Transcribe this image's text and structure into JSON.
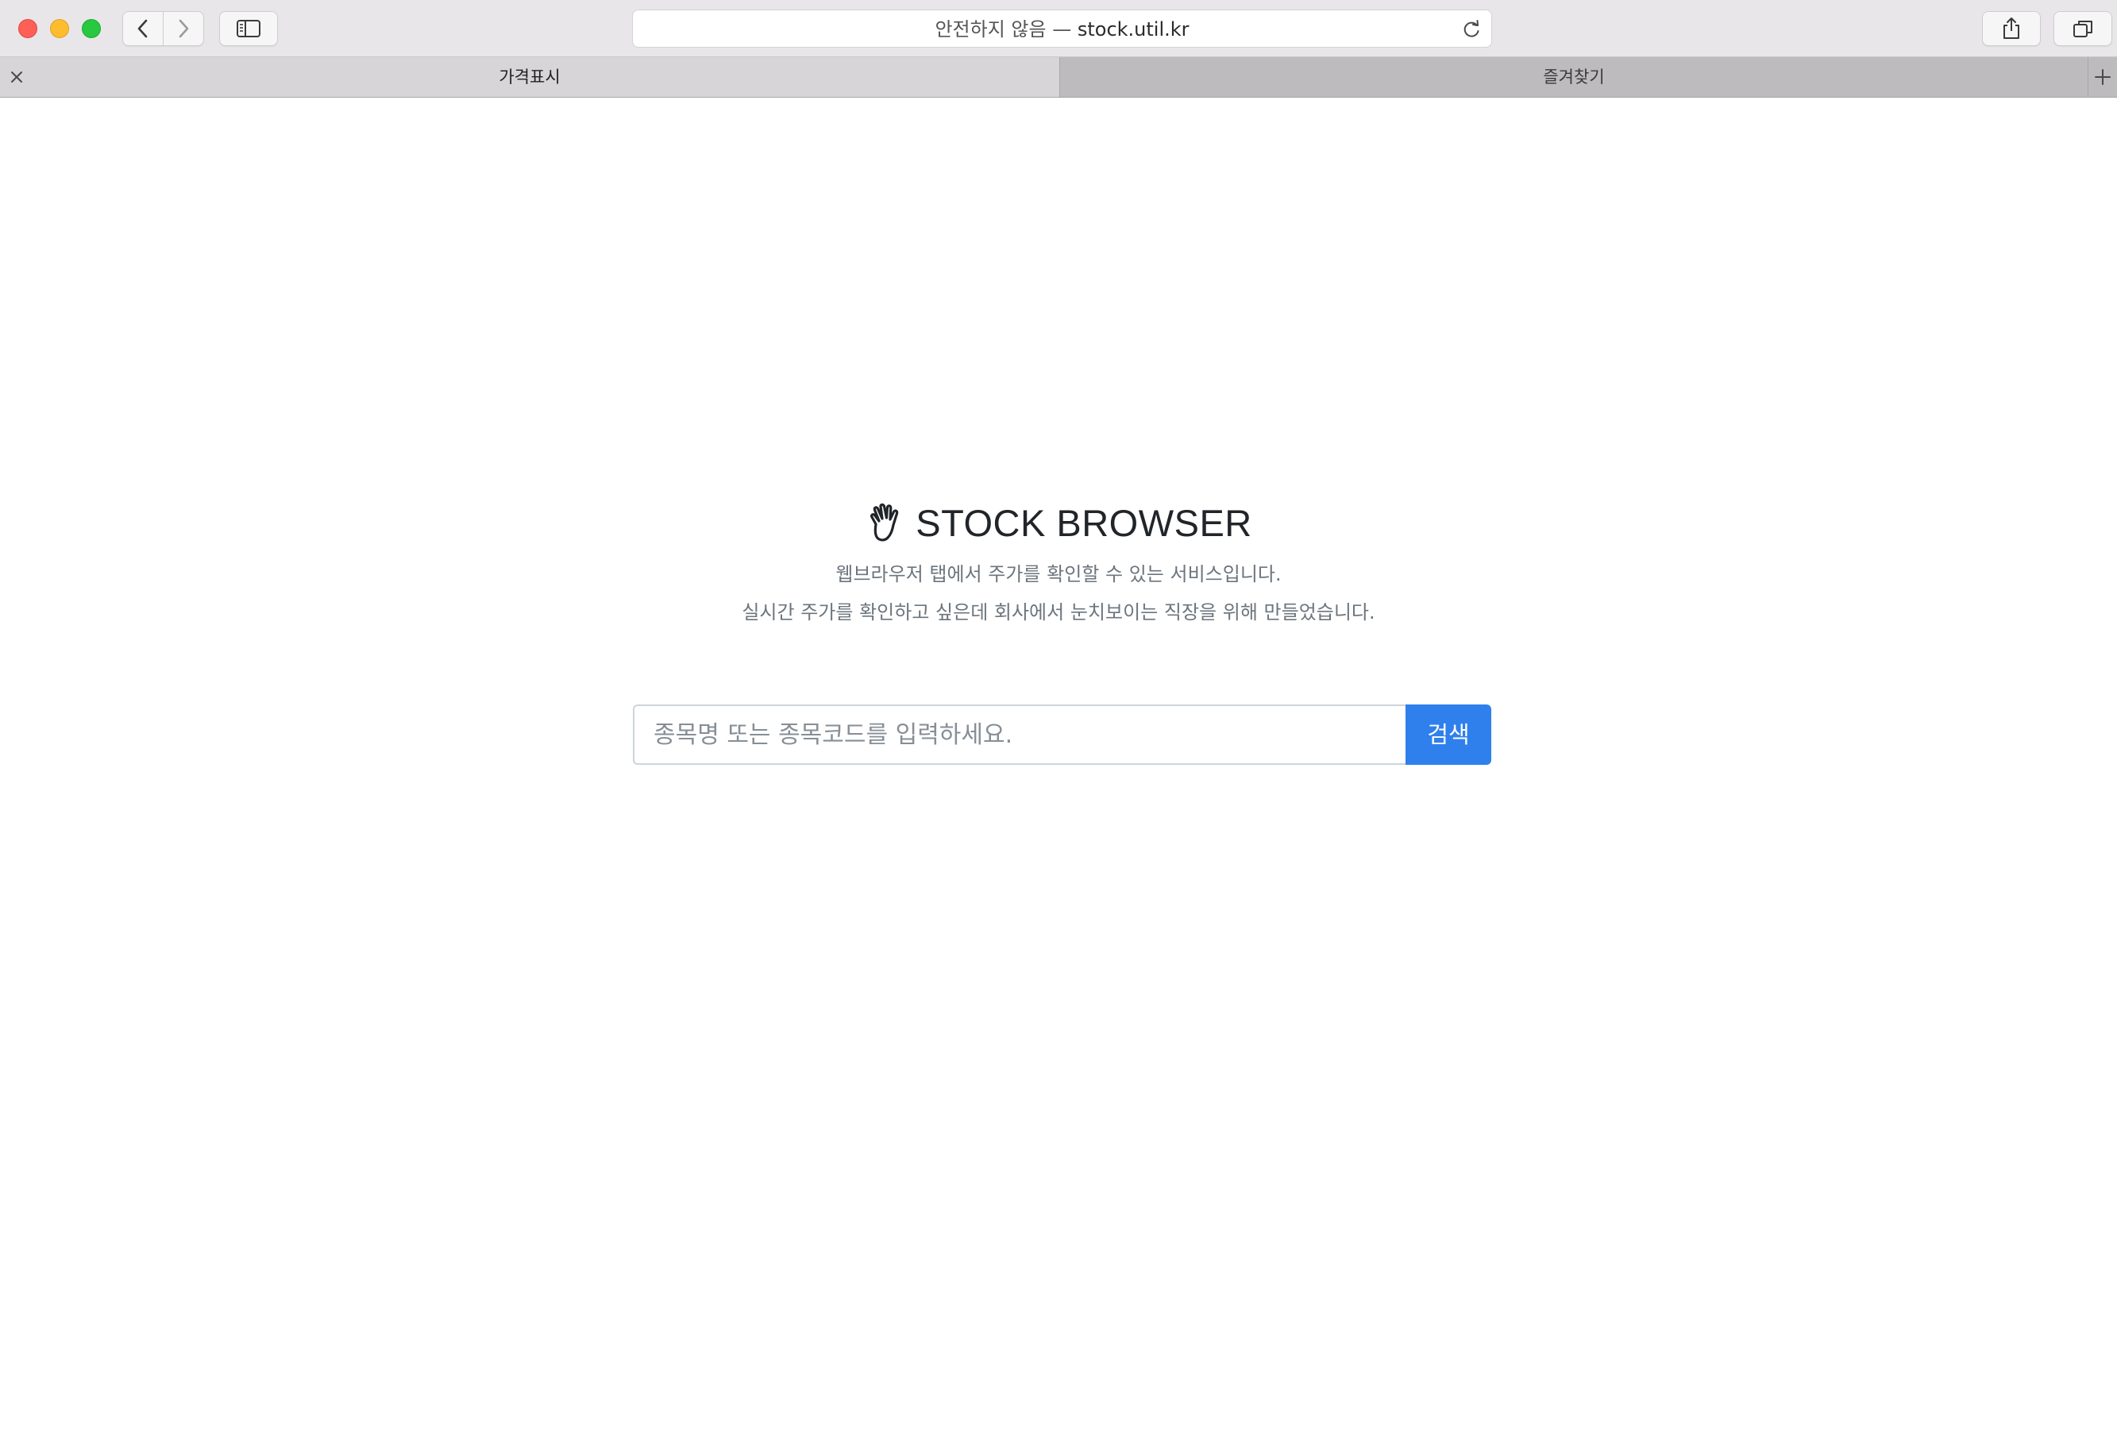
{
  "browser": {
    "address_prefix": "안전하지 않음 —",
    "address_domain": "stock.util.kr",
    "tabs": [
      {
        "label": "가격표시",
        "active": true
      },
      {
        "label": "즐겨찾기",
        "active": false
      }
    ]
  },
  "page": {
    "title": "STOCK BROWSER",
    "title_icon": "waving-hand-icon",
    "description_line1": "웹브라우저 탭에서 주가를 확인할 수 있는 서비스입니다.",
    "description_line2": "실시간 주가를 확인하고 싶은데 회사에서 눈치보이는 직장을 위해 만들었습니다.",
    "search": {
      "placeholder": "종목명 또는 종목코드를 입력하세요.",
      "value": "",
      "button_label": "검색",
      "button_color": "#2f80ed"
    }
  }
}
